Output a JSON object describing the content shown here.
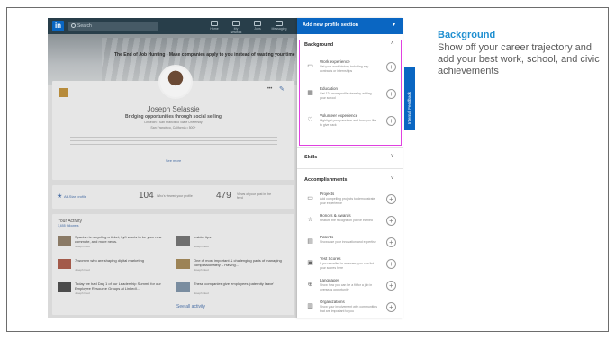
{
  "app": {
    "logo": "in",
    "search_placeholder": "Search",
    "nav": [
      "Home",
      "My Network",
      "Jobs",
      "Messaging"
    ],
    "promo": "The End of Job Hunting - Make companies apply to you instead of wasting your time"
  },
  "profile": {
    "name": "Joseph Selassie",
    "headline": "Bridging opportunities through social selling",
    "company": "LinkedIn • San Francisco State University",
    "location": "San Francisco, California • 500+",
    "see_more": "See more"
  },
  "stats": {
    "label": "All-Star profile",
    "views": "104",
    "views_label": "Who's viewed your profile",
    "appearances": "479",
    "appearances_label": "Views of your post in the feed"
  },
  "activity": {
    "title": "Your Activity",
    "followers": "1,655 followers",
    "posts": [
      {
        "title": "Spanish is recycling a ticket, Lyft wants to be your new commute, and more news.",
        "meta": "Joseph liked"
      },
      {
        "title": "Insider tips",
        "meta": "Joseph liked"
      },
      {
        "title": "7 women who are shaping digital marketing",
        "meta": "Joseph liked"
      },
      {
        "title": "One of most important & challenging parts of managing compassionately – Having...",
        "meta": "Joseph liked"
      },
      {
        "title": "Today we had Day 1 of our Leadership Summit for our Employee Resource Groups at LinkedI...",
        "meta": "Joseph liked"
      },
      {
        "title": "These companies give employees 'paternity leave'",
        "meta": "Joseph liked"
      }
    ],
    "see_all": "See all activity"
  },
  "feedback": "Internal Feedback",
  "panel": {
    "title": "Add new profile section",
    "sections": {
      "background": {
        "label": "Background",
        "items": [
          {
            "icon": "briefcase-icon",
            "title": "Work experience",
            "desc": "List your work history including any contracts or internships"
          },
          {
            "icon": "graduation-icon",
            "title": "Education",
            "desc": "Get 12x more profile views by adding your school"
          },
          {
            "icon": "heart-icon",
            "title": "Volunteer experience",
            "desc": "Highlight your passions and how you like to give back"
          }
        ]
      },
      "skills": {
        "label": "Skills"
      },
      "accomplishments": {
        "label": "Accomplishments",
        "items": [
          {
            "icon": "projects-icon",
            "title": "Projects",
            "desc": "Add compelling projects to demonstrate your experience"
          },
          {
            "icon": "trophy-icon",
            "title": "Honors & Awards",
            "desc": "Feature the recognition you've earned"
          },
          {
            "icon": "patent-icon",
            "title": "Patents",
            "desc": "Showcase your innovation and expertise"
          },
          {
            "icon": "clipboard-icon",
            "title": "Test Scores",
            "desc": "If you excelled in an exam, you can list your scores here"
          },
          {
            "icon": "globe-icon",
            "title": "Languages",
            "desc": "Show how you can be a fit for a job in overseas opportunity"
          },
          {
            "icon": "organization-icon",
            "title": "Organizations",
            "desc": "Show your involvement with communities that are important to you"
          }
        ]
      }
    }
  },
  "callout": {
    "title": "Background",
    "text": "Show off your career trajectory and add your best work, school, and civic achievements"
  },
  "colors": {
    "accent": "#0a66c2",
    "highlight": "#e040e0",
    "callout_title": "#1f8fd0"
  }
}
